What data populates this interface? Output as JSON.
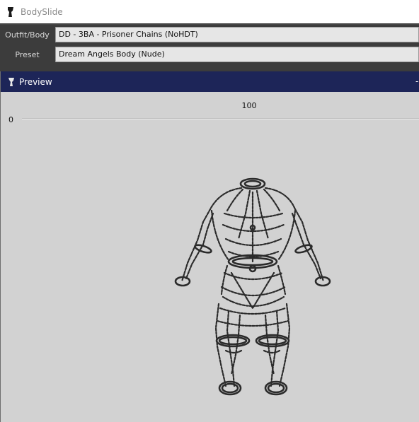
{
  "app": {
    "title": "BodySlide",
    "icon": "bodyslide-app-icon"
  },
  "outfit": {
    "label": "Outfit/Body",
    "value": "DD - 3BA - Prisoner Chains (NoHDT)"
  },
  "preset": {
    "label": "Preset",
    "value": "Dream Angels Body (Nude)"
  },
  "preview": {
    "title": "Preview",
    "icon": "bodyslide-preview-icon",
    "minimize_glyph": "-",
    "slider": {
      "min_label": "0",
      "max_label": "100"
    },
    "mesh": "prisoner-chains-wireframe"
  },
  "colors": {
    "titlebar_bg": "#ffffff",
    "panel_bg": "#3c3c3c",
    "combo_bg": "#e6e6e6",
    "preview_header": "#1d2558",
    "viewport_bg": "#d2d2d2",
    "mesh_stroke": "#2b2b2b"
  }
}
